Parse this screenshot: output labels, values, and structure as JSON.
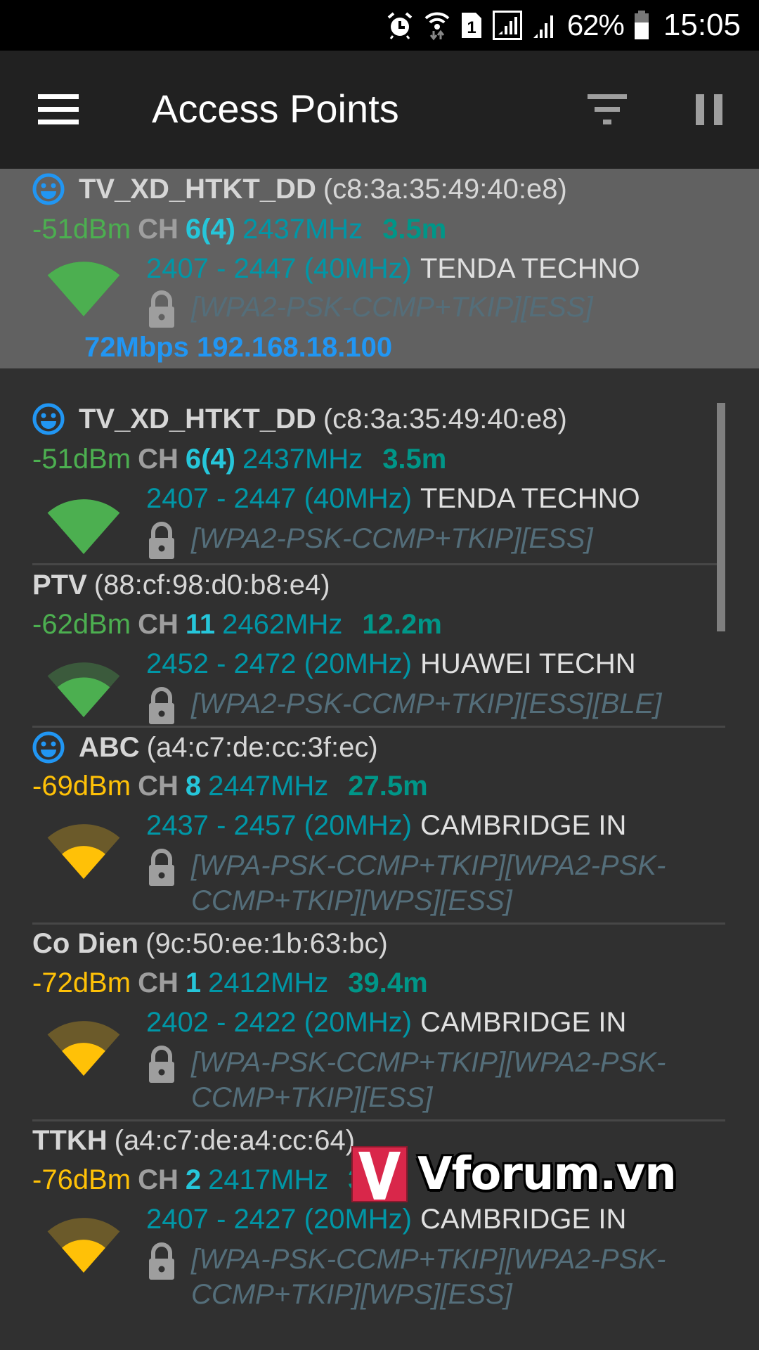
{
  "status_bar": {
    "icons": [
      "alarm-icon",
      "wifi-data-icon",
      "sim1-icon",
      "signal-sim1-icon",
      "signal-sim2-icon",
      "battery-icon"
    ],
    "sim_label": "1",
    "battery": "62%",
    "time": "15:05"
  },
  "toolbar": {
    "title": "Access Points",
    "menu_icon": "menu-icon",
    "filter_icon": "filter-icon",
    "pause_icon": "pause-icon"
  },
  "connected": {
    "ssid": "TV_XD_HTKT_DD",
    "bssid": "(c8:3a:35:49:40:e8)",
    "saved": true,
    "dbm": "-51dBm",
    "ch_label": "CH",
    "channel": "6(4)",
    "freq": "2437MHz",
    "distance": "3.5m",
    "range": "2407 - 2447 (40MHz)",
    "vendor": "TENDA TECHNO",
    "capabilities": "[WPA2-PSK-CCMP+TKIP][ESS]",
    "signal_level": 1.0,
    "speed_ip": "72Mbps 192.168.18.100"
  },
  "access_points": [
    {
      "ssid": "TV_XD_HTKT_DD",
      "bssid": "(c8:3a:35:49:40:e8)",
      "saved": true,
      "dbm": "-51dBm",
      "strength": "good",
      "ch_label": "CH",
      "channel": "6(4)",
      "freq": "2437MHz",
      "distance": "3.5m",
      "range": "2407 - 2447 (40MHz)",
      "vendor": "TENDA TECHNO",
      "capabilities": "[WPA2-PSK-CCMP+TKIP][ESS]",
      "signal_level": 1.0
    },
    {
      "ssid": "PTV",
      "bssid": "(88:cf:98:d0:b8:e4)",
      "saved": false,
      "dbm": "-62dBm",
      "strength": "good",
      "ch_label": "CH",
      "channel": "11",
      "freq": "2462MHz",
      "distance": "12.2m",
      "range": "2452 - 2472 (20MHz)",
      "vendor": "HUAWEI TECHN",
      "capabilities": "[WPA2-PSK-CCMP+TKIP][ESS][BLE]",
      "signal_level": 0.75
    },
    {
      "ssid": "ABC",
      "bssid": "(a4:c7:de:cc:3f:ec)",
      "saved": true,
      "dbm": "-69dBm",
      "strength": "fair",
      "ch_label": "CH",
      "channel": "8",
      "freq": "2447MHz",
      "distance": "27.5m",
      "range": "2437 - 2457 (20MHz)",
      "vendor": "CAMBRIDGE IN",
      "capabilities": "[WPA-PSK-CCMP+TKIP][WPA2-PSK-CCMP+TKIP][WPS][ESS]",
      "signal_level": 0.5
    },
    {
      "ssid": "Co Dien",
      "bssid": "(9c:50:ee:1b:63:bc)",
      "saved": false,
      "dbm": "-72dBm",
      "strength": "fair",
      "ch_label": "CH",
      "channel": "1",
      "freq": "2412MHz",
      "distance": "39.4m",
      "range": "2402 - 2422 (20MHz)",
      "vendor": "CAMBRIDGE IN",
      "capabilities": "[WPA-PSK-CCMP+TKIP][WPA2-PSK-CCMP+TKIP][ESS]",
      "signal_level": 0.5
    },
    {
      "ssid": "TTKH",
      "bssid": "(a4:c7:de:a4:cc:64)",
      "saved": false,
      "dbm": "-76dBm",
      "strength": "fair",
      "ch_label": "CH",
      "channel": "2",
      "freq": "2417MHz",
      "distance": "3",
      "range": "2407 - 2427 (20MHz)",
      "vendor": "CAMBRIDGE IN",
      "capabilities": "[WPA-PSK-CCMP+TKIP][WPA2-PSK-CCMP+TKIP][WPS][ESS]",
      "signal_level": 0.5
    }
  ],
  "colors": {
    "good": "#4caf50",
    "good_dim": "#3b5a3c",
    "fair": "#ffc107",
    "fair_dim": "#6b5a2a",
    "accent_blue": "#2196f3",
    "channel": "#26c6da",
    "freq": "#0097a7",
    "distance": "#009688"
  },
  "watermark": {
    "text": "Vforum.vn"
  }
}
